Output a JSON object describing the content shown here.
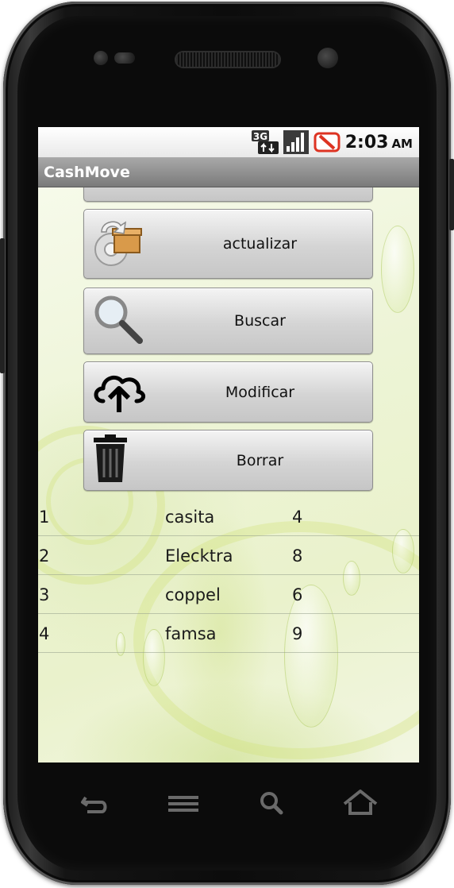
{
  "status_bar": {
    "network_icon": "3g-data-icon",
    "signal_icon": "signal-strength-icon",
    "notification_icon": "no-alert-icon",
    "time": "2:03",
    "ampm": "AM"
  },
  "app": {
    "title": "CashMove"
  },
  "buttons": [
    {
      "label": "actualizar",
      "icon": "archive-update-icon"
    },
    {
      "label": "Buscar",
      "icon": "magnifier-icon"
    },
    {
      "label": "Modificar",
      "icon": "cloud-upload-icon"
    },
    {
      "label": "Borrar",
      "icon": "trash-icon"
    }
  ],
  "rows": [
    {
      "id": "1",
      "name": "casita",
      "value": "4"
    },
    {
      "id": "2",
      "name": "Elecktra",
      "value": "8"
    },
    {
      "id": "3",
      "name": "coppel",
      "value": "6"
    },
    {
      "id": "4",
      "name": "famsa",
      "value": "9"
    }
  ],
  "nav": [
    "back-icon",
    "menu-icon",
    "search-icon",
    "home-icon"
  ]
}
